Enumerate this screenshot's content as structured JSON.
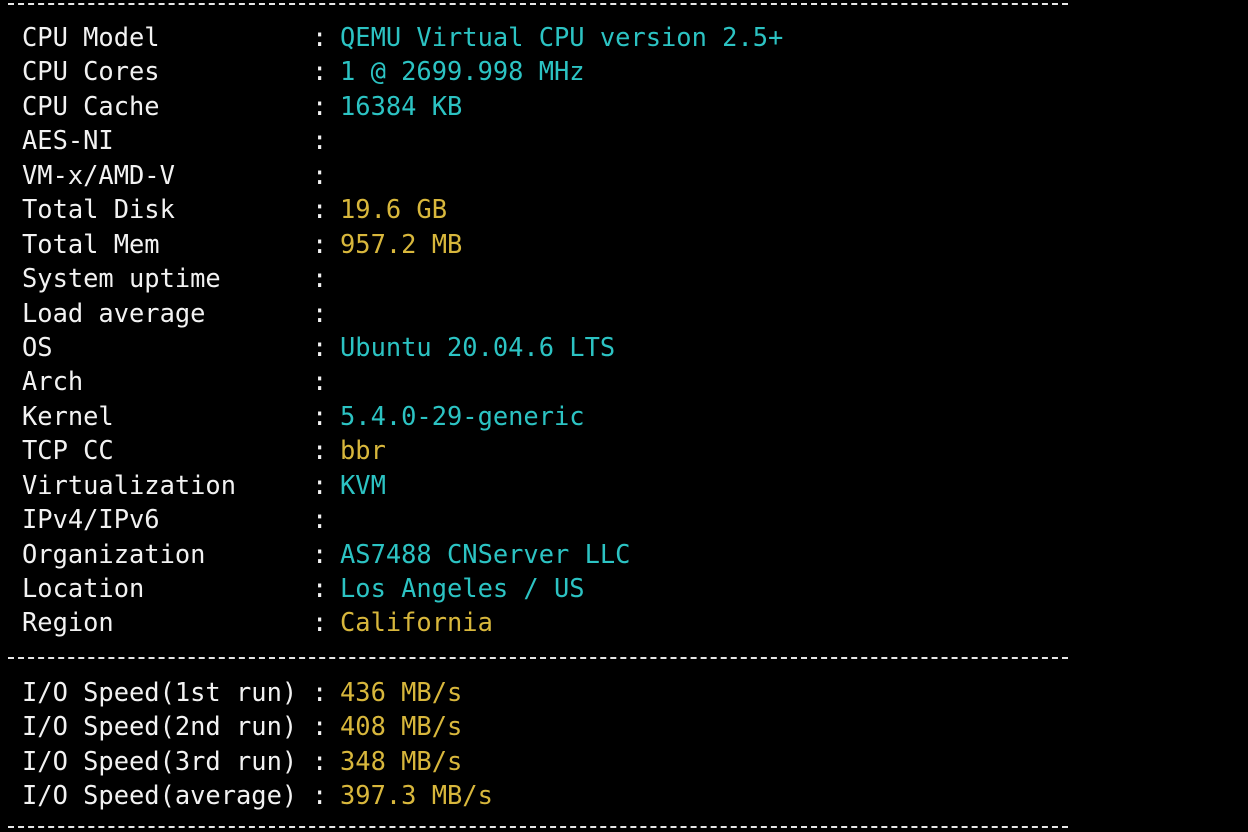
{
  "separator": "------------------------------------------------------------------------",
  "colors": {
    "background": "#000000",
    "label": "#f2f2f2",
    "cyan": "#2cc3c3",
    "yellow": "#d8b73c"
  },
  "system_info": [
    {
      "label": "CPU Model",
      "value": "QEMU Virtual CPU version 2.5+",
      "color": "cyan"
    },
    {
      "label": "CPU Cores",
      "value": "1 @ 2699.998 MHz",
      "color": "cyan"
    },
    {
      "label": "CPU Cache",
      "value": "16384 KB",
      "color": "cyan"
    },
    {
      "label": "AES-NI",
      "value": "",
      "color": "cyan"
    },
    {
      "label": "VM-x/AMD-V",
      "value": "",
      "color": "cyan"
    },
    {
      "label": "Total Disk",
      "value": "19.6 GB",
      "color": "yellow"
    },
    {
      "label": "Total Mem",
      "value": "957.2 MB",
      "color": "yellow"
    },
    {
      "label": "System uptime",
      "value": "",
      "color": "cyan"
    },
    {
      "label": "Load average",
      "value": "",
      "color": "cyan"
    },
    {
      "label": "OS",
      "value": "Ubuntu 20.04.6 LTS",
      "color": "cyan"
    },
    {
      "label": "Arch",
      "value": "",
      "color": "cyan"
    },
    {
      "label": "Kernel",
      "value": "5.4.0-29-generic",
      "color": "cyan"
    },
    {
      "label": "TCP CC",
      "value": "bbr",
      "color": "yellow"
    },
    {
      "label": "Virtualization",
      "value": "KVM",
      "color": "cyan"
    },
    {
      "label": "IPv4/IPv6",
      "value": "",
      "color": "cyan"
    },
    {
      "label": "Organization",
      "value": "AS7488 CNServer LLC",
      "color": "cyan"
    },
    {
      "label": "Location",
      "value": "Los Angeles / US",
      "color": "cyan"
    },
    {
      "label": "Region",
      "value": "California",
      "color": "yellow"
    }
  ],
  "io_speed": [
    {
      "label": "I/O Speed(1st run)",
      "value": "436 MB/s",
      "color": "yellow"
    },
    {
      "label": "I/O Speed(2nd run)",
      "value": "408 MB/s",
      "color": "yellow"
    },
    {
      "label": "I/O Speed(3rd run)",
      "value": "348 MB/s",
      "color": "yellow"
    },
    {
      "label": "I/O Speed(average)",
      "value": "397.3 MB/s",
      "color": "yellow"
    }
  ]
}
